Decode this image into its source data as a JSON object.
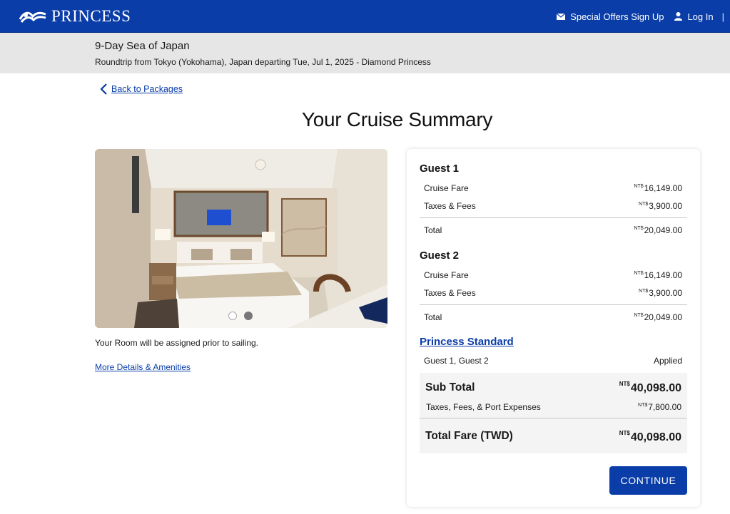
{
  "header": {
    "logo_text": "PRINCESS",
    "special_offers": "Special Offers Sign Up",
    "login": "Log In",
    "separator": "|"
  },
  "trip": {
    "title": "9-Day Sea of Japan",
    "subtitle": "Roundtrip from Tokyo (Yokohama), Japan departing Tue, Jul 1, 2025 - Diamond Princess"
  },
  "nav": {
    "back_label": "Back to Packages"
  },
  "page_title": "Your Cruise Summary",
  "room": {
    "note": "Your Room will be assigned prior to sailing.",
    "more_link": "More Details & Amenities",
    "carousel": {
      "slides": 2,
      "active": 1
    }
  },
  "currency_prefix": "NT$",
  "guests": [
    {
      "title": "Guest 1",
      "fare_label": "Cruise Fare",
      "fare": "16,149.00",
      "taxes_label": "Taxes & Fees",
      "taxes": "3,900.00",
      "total_label": "Total",
      "total": "20,049.00"
    },
    {
      "title": "Guest 2",
      "fare_label": "Cruise Fare",
      "fare": "16,149.00",
      "taxes_label": "Taxes & Fees",
      "taxes": "3,900.00",
      "total_label": "Total",
      "total": "20,049.00"
    }
  ],
  "package": {
    "name": "Princess Standard",
    "guests": "Guest 1, Guest 2",
    "status": "Applied"
  },
  "summary": {
    "subtotal_label": "Sub Total",
    "subtotal": "40,098.00",
    "ports_label": "Taxes, Fees, & Port Expenses",
    "ports": "7,800.00",
    "total_label": "Total Fare (TWD)",
    "total": "40,098.00"
  },
  "continue_label": "CONTINUE",
  "colors": {
    "brand": "#0a3da8",
    "subheader_bg": "#e6e6e6",
    "summary_bg": "#f4f4f4"
  }
}
